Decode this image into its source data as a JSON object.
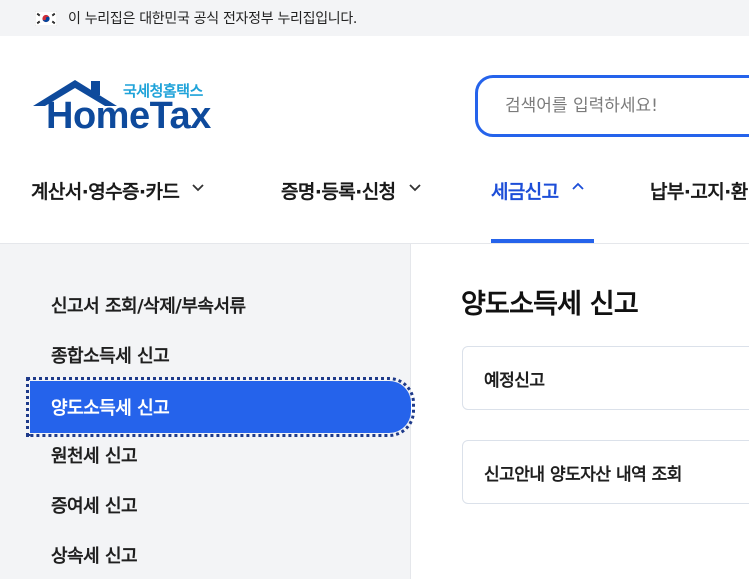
{
  "gov_banner": {
    "text": "이 누리집은 대한민국 공식 전자정부 누리집입니다.",
    "flag_icon": "korea-flag-icon"
  },
  "logo": {
    "subtitle": "국세청홈택스",
    "title": "HomeTax",
    "colors": {
      "roof": "#0e4a9c",
      "subtitle": "#1fa3d9"
    }
  },
  "search": {
    "placeholder": "검색어를 입력하세요!"
  },
  "gnb": {
    "items": [
      {
        "label": "계산서·영수증·카드",
        "expanded": false
      },
      {
        "label": "증명·등록·신청",
        "expanded": false
      },
      {
        "label": "세금신고",
        "expanded": true
      },
      {
        "label": "납부·고지·환",
        "expanded": false
      }
    ],
    "accent": "#2563eb"
  },
  "lnb": {
    "items": [
      {
        "label": "신고서 조회/삭제/부속서류"
      },
      {
        "label": "종합소득세 신고"
      },
      {
        "label": "양도소득세 신고",
        "active": true
      },
      {
        "label": "원천세 신고"
      },
      {
        "label": "증여세 신고"
      },
      {
        "label": "상속세 신고"
      }
    ]
  },
  "content": {
    "title": "양도소득세 신고",
    "cards": [
      {
        "label": "예정신고"
      },
      {
        "label": "신고안내 양도자산 내역 조회"
      }
    ]
  }
}
